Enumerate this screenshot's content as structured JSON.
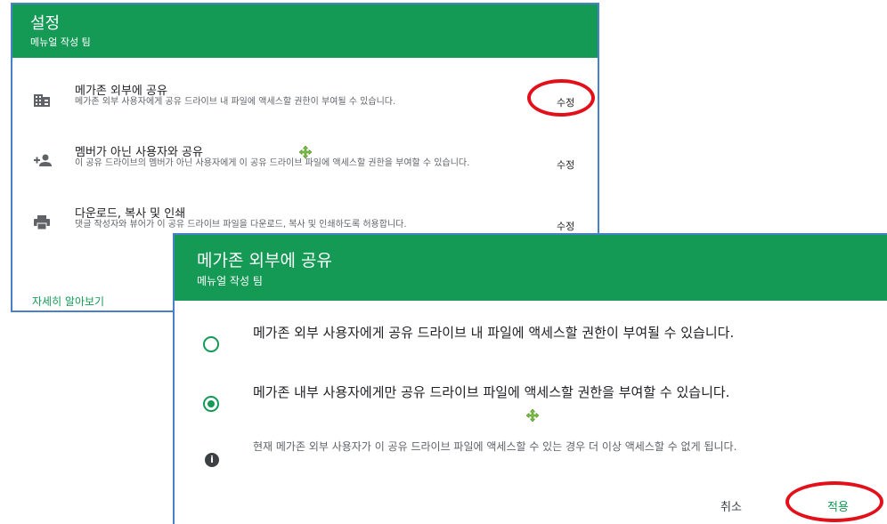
{
  "settings": {
    "title": "설정",
    "subtitle": "메뉴얼 작성 팀",
    "rows": [
      {
        "icon": "building-icon",
        "title": "메가존 외부에 공유",
        "desc": "메가존 외부 사용자에게 공유 드라이브 내 파일에 액세스할 권한이 부여될 수 있습니다.",
        "edit": "수정"
      },
      {
        "icon": "person-add-icon",
        "title": "멤버가 아닌 사용자와 공유",
        "desc": "이 공유 드라이브의 멤버가 아닌 사용자에게 이 공유 드라이브 파일에 액세스할 권한을 부여할 수 있습니다.",
        "edit": "수정"
      },
      {
        "icon": "print-icon",
        "title": "다운로드, 복사 및 인쇄",
        "desc": "댓글 작성자와 뷰어가 이 공유 드라이브 파일을 다운로드, 복사 및 인쇄하도록 허용합니다.",
        "edit": "수정"
      }
    ],
    "learn_more": "자세히 알아보기"
  },
  "dialog": {
    "title": "메가존 외부에 공유",
    "subtitle": "메뉴얼 작성 팀",
    "options": [
      {
        "label": "메가존 외부 사용자에게 공유 드라이브 내 파일에 액세스할 권한이 부여될 수 있습니다.",
        "selected": false
      },
      {
        "label": "메가존 내부 사용자에게만 공유 드라이브 파일에 액세스할 권한을 부여할 수 있습니다.",
        "selected": true
      }
    ],
    "info": "현재 메가존 외부 사용자가 이 공유 드라이브 파일에 액세스할 수 있는 경우 더 이상 액세스할 수 없게 됩니다.",
    "cancel": "취소",
    "apply": "적용"
  },
  "colors": {
    "accent": "#149a55",
    "annotation": "#e3101a",
    "panel_border": "#4a7fc9"
  }
}
